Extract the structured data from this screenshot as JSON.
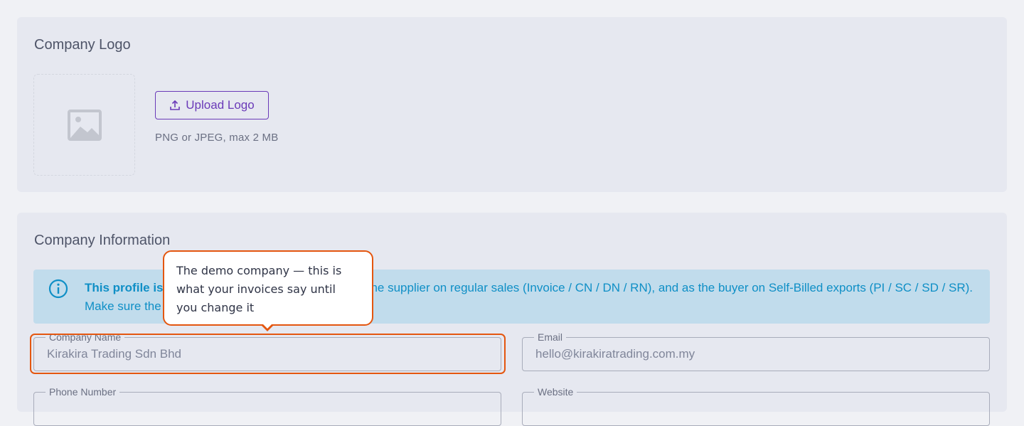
{
  "logo_card": {
    "title": "Company Logo",
    "upload_label": "Upload Logo",
    "hint": "PNG or JPEG, max 2 MB"
  },
  "info_card": {
    "title": "Company Information",
    "alert": {
      "bold_text": "This profile is used on every e-invoice export.",
      "text": " As the supplier on regular sales (Invoice / CN / DN / RN), and as the buyer on Self-Billed exports (PI / SC / SD / SR). Make sure the TIN and address are accurate."
    },
    "fields": {
      "company_name": {
        "label": "Company Name",
        "value": "Kirakira Trading Sdn Bhd"
      },
      "email": {
        "label": "Email",
        "value": "hello@kirakiratrading.com.my"
      },
      "phone": {
        "label": "Phone Number",
        "value": ""
      },
      "website": {
        "label": "Website",
        "value": ""
      }
    }
  },
  "tooltip": {
    "text": "The demo company — this is what your invoices say until you change it"
  },
  "colors": {
    "accent": "#6a3ab8",
    "highlight": "#e4560f",
    "info": "#0f8fc6",
    "info_bg": "#c1dcec"
  }
}
